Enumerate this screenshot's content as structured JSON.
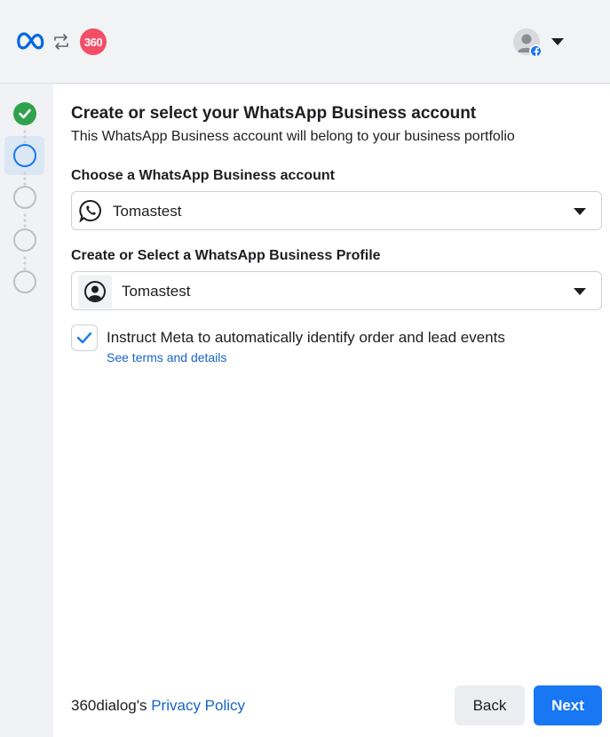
{
  "header": {
    "brand_text": "360",
    "colors": {
      "meta_blue": "#0668e1",
      "brand_red": "#f34d67",
      "fb_blue": "#1877f2"
    }
  },
  "steps": [
    {
      "status": "done",
      "icon": "check-icon"
    },
    {
      "status": "active"
    },
    {
      "status": "pending"
    },
    {
      "status": "pending"
    },
    {
      "status": "pending"
    }
  ],
  "main": {
    "title": "Create or select your WhatsApp Business account",
    "subtitle": "This WhatsApp Business account will belong to your business portfolio",
    "account_label": "Choose a WhatsApp Business account",
    "account_value": "Tomastest",
    "profile_label": "Create or Select a WhatsApp Business Profile",
    "profile_value": "Tomastest",
    "checkbox_checked": true,
    "checkbox_label": "Instruct Meta to automatically identify order and lead events",
    "terms_link": "See terms and details"
  },
  "footer": {
    "policy_prefix": "360dialog's",
    "policy_link": "Privacy Policy",
    "back_label": "Back",
    "next_label": "Next"
  }
}
